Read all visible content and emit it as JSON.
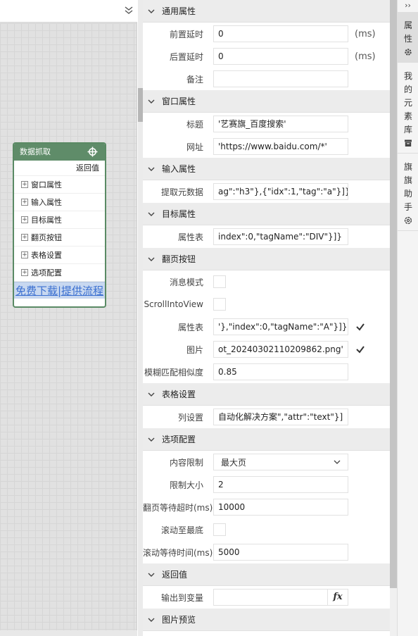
{
  "canvas": {
    "node": {
      "title": "数据抓取",
      "return_label": "返回值",
      "items": [
        "窗口属性",
        "输入属性",
        "目标属性",
        "翻页按钮",
        "表格设置",
        "选项配置"
      ],
      "link_text": "免费下载|提供流程"
    }
  },
  "panel": {
    "general": {
      "title": "通用属性",
      "pre_delay_label": "前置延时",
      "pre_delay_value": "0",
      "pre_delay_unit": "(ms)",
      "post_delay_label": "后置延时",
      "post_delay_value": "0",
      "post_delay_unit": "(ms)",
      "note_label": "备注",
      "note_value": ""
    },
    "window": {
      "title": "窗口属性",
      "title_label": "标题",
      "title_value": "'艺赛旗_百度搜索'",
      "url_label": "网址",
      "url_value": "'https://www.baidu.com/*'"
    },
    "input": {
      "title": "输入属性",
      "extract_label": "提取元数据",
      "extract_value": "ag\":\"h3\"},{\"idx\":1,\"tag\":\"a\"}]}]"
    },
    "target": {
      "title": "目标属性",
      "attr_label": "属性表",
      "attr_value": "index\":0,\"tagName\":\"DIV\"}]}"
    },
    "pager": {
      "title": "翻页按钮",
      "msg_mode_label": "消息模式",
      "scroll_label": "ScrollIntoView",
      "attr_label": "属性表",
      "attr_value": "'},\"index\":0,\"tagName\":\"A\"}]}",
      "image_label": "图片",
      "image_value": "ot_20240302110209862.png'",
      "fuzzy_label": "模糊匹配相似度",
      "fuzzy_value": "0.85"
    },
    "table": {
      "title": "表格设置",
      "col_label": "列设置",
      "col_value": "自动化解决方案\",\"attr\":\"text\"}]"
    },
    "options": {
      "title": "选项配置",
      "limit_label": "内容限制",
      "limit_value": "最大页",
      "limit_size_label": "限制大小",
      "limit_size_value": "2",
      "page_timeout_label": "翻页等待超时(ms)",
      "page_timeout_value": "10000",
      "scroll_bottom_label": "滚动至最底",
      "scroll_wait_label": "滚动等待时间(ms)",
      "scroll_wait_value": "5000"
    },
    "return": {
      "title": "返回值",
      "output_label": "输出到变量",
      "output_value": "",
      "fx_label": "fx"
    },
    "preview": {
      "title": "图片预览"
    }
  },
  "rightbar": {
    "collapse_label": "››",
    "tabs": [
      {
        "label": "属性",
        "icon": "gear-icon"
      },
      {
        "label": "我的元素库",
        "icon": "archive-icon"
      },
      {
        "label": "旗旗助手",
        "icon": "openai-icon"
      }
    ]
  }
}
